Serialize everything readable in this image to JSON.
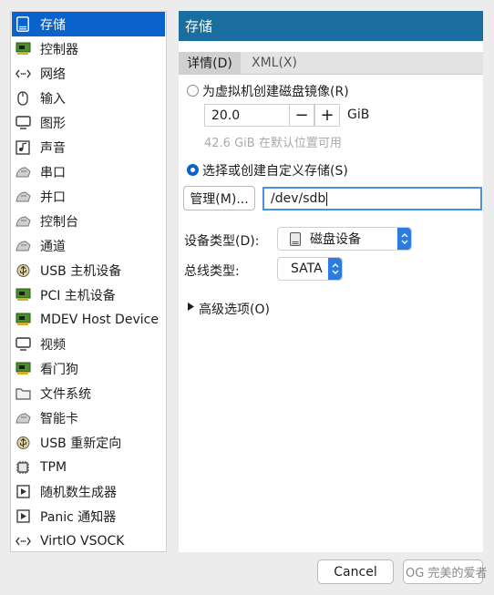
{
  "sidebar": {
    "items": [
      {
        "label": "存储",
        "icon": "storage-disk-icon",
        "selected": true
      },
      {
        "label": "控制器",
        "icon": "controller-card-icon"
      },
      {
        "label": "网络",
        "icon": "network-icon"
      },
      {
        "label": "输入",
        "icon": "mouse-icon"
      },
      {
        "label": "图形",
        "icon": "monitor-icon"
      },
      {
        "label": "声音",
        "icon": "sound-icon"
      },
      {
        "label": "串口",
        "icon": "serial-port-icon"
      },
      {
        "label": "并口",
        "icon": "parallel-port-icon"
      },
      {
        "label": "控制台",
        "icon": "console-icon"
      },
      {
        "label": "通道",
        "icon": "channel-icon"
      },
      {
        "label": "USB 主机设备",
        "icon": "usb-icon"
      },
      {
        "label": "PCI 主机设备",
        "icon": "pci-card-icon"
      },
      {
        "label": "MDEV Host Device",
        "icon": "mdev-card-icon"
      },
      {
        "label": "视频",
        "icon": "video-monitor-icon"
      },
      {
        "label": "看门狗",
        "icon": "watchdog-card-icon"
      },
      {
        "label": "文件系统",
        "icon": "folder-icon"
      },
      {
        "label": "智能卡",
        "icon": "smartcard-icon"
      },
      {
        "label": "USB 重新定向",
        "icon": "usb-redirect-icon"
      },
      {
        "label": "TPM",
        "icon": "chip-icon"
      },
      {
        "label": "随机数生成器",
        "icon": "rng-icon"
      },
      {
        "label": "Panic 通知器",
        "icon": "panic-icon"
      },
      {
        "label": "VirtIO VSOCK",
        "icon": "vsock-icon"
      }
    ]
  },
  "main": {
    "title": "存储",
    "tabs": [
      {
        "label": "详情(D)",
        "active": true
      },
      {
        "label": "XML(X)",
        "active": false
      }
    ],
    "create_image": {
      "label": "为虚拟机创建磁盘镜像(R)",
      "size_value": "20.0",
      "minus": "−",
      "plus": "+",
      "unit": "GiB",
      "available": "42.6 GiB 在默认位置可用"
    },
    "custom_storage": {
      "label": "选择或创建自定义存储(S)",
      "manage_label": "管理(M)...",
      "path_value": "/dev/sdb"
    },
    "device_type": {
      "label": "设备类型(D):",
      "value": "磁盘设备"
    },
    "bus_type": {
      "label": "总线类型:",
      "value": "SATA"
    },
    "advanced": {
      "label": "高级选项(O)"
    }
  },
  "footer": {
    "cancel_label": "Cancel",
    "watermark": "OG 完美的爱者"
  },
  "colors": {
    "selection": "#0a63cc",
    "title_bar": "#1a6e9f",
    "select_arrow": "#2b7be0"
  }
}
